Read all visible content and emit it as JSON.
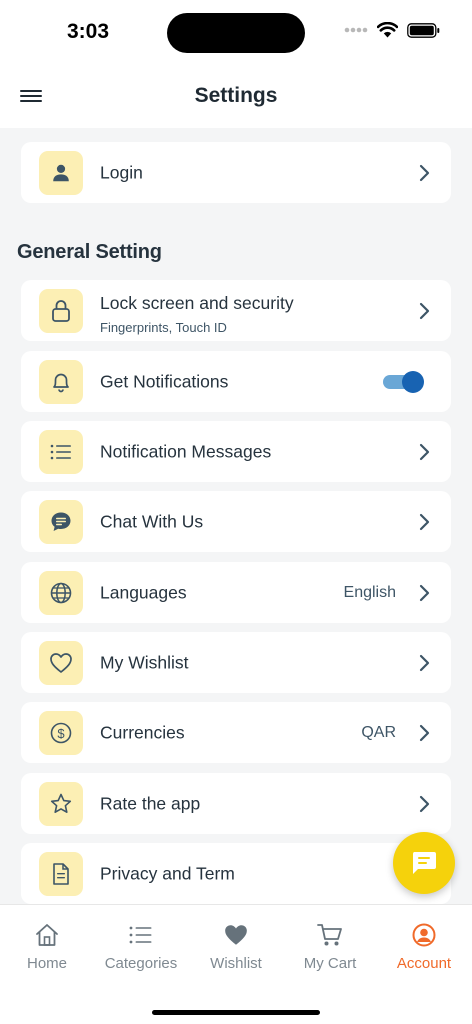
{
  "status_bar": {
    "time": "3:03"
  },
  "header": {
    "title": "Settings"
  },
  "login": {
    "label": "Login",
    "icon": "person-icon"
  },
  "general_section": {
    "title": "General Setting"
  },
  "settings": {
    "lock": {
      "label": "Lock screen and security",
      "sub": "Fingerprints, Touch ID",
      "icon": "lock-icon"
    },
    "notifications": {
      "label": "Get Notifications",
      "enabled": true,
      "icon": "bell-icon"
    },
    "messages": {
      "label": "Notification Messages",
      "icon": "list-icon"
    },
    "chat": {
      "label": "Chat With Us",
      "icon": "chat-bubble-icon"
    },
    "languages": {
      "label": "Languages",
      "value": "English",
      "icon": "globe-icon"
    },
    "wishlist": {
      "label": "My Wishlist",
      "icon": "heart-icon"
    },
    "currencies": {
      "label": "Currencies",
      "value": "QAR",
      "icon": "dollar-icon"
    },
    "rate": {
      "label": "Rate the app",
      "icon": "star-icon"
    },
    "privacy": {
      "label": "Privacy and Term",
      "icon": "document-icon"
    }
  },
  "tabbar": {
    "items": [
      {
        "label": "Home",
        "icon": "home-icon"
      },
      {
        "label": "Categories",
        "icon": "list-icon"
      },
      {
        "label": "Wishlist",
        "icon": "heart-filled-icon"
      },
      {
        "label": "My Cart",
        "icon": "cart-icon"
      },
      {
        "label": "Account",
        "icon": "account-icon",
        "active": true
      }
    ]
  },
  "colors": {
    "icon_background": "#fcefb4",
    "accent_active": "#f06a2a",
    "fab": "#f5d20c",
    "toggle_on": "#1863b2"
  }
}
